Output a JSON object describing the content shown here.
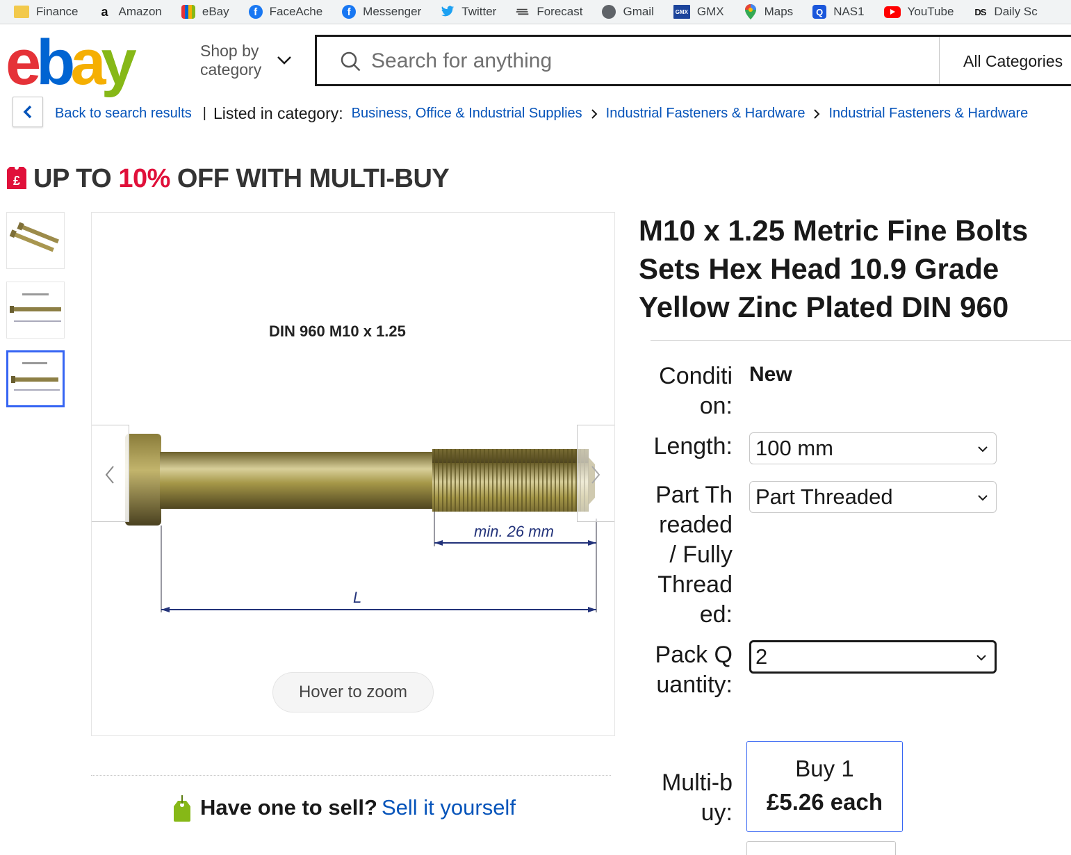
{
  "bookmarks": [
    {
      "label": "Finance",
      "icon": "folder-icon",
      "color": "#f2c94c"
    },
    {
      "label": "Amazon",
      "icon": "amazon-icon",
      "color": "#ffffff"
    },
    {
      "label": "eBay",
      "icon": "ebay-bag-icon",
      "color": "#0064d2"
    },
    {
      "label": "FaceAche",
      "icon": "facebook-icon",
      "color": "#1877f2"
    },
    {
      "label": "Messenger",
      "icon": "facebook-icon",
      "color": "#1877f2"
    },
    {
      "label": "Twitter",
      "icon": "twitter-icon",
      "color": "#1da1f2"
    },
    {
      "label": "Forecast",
      "icon": "forecast-icon",
      "color": "#555555"
    },
    {
      "label": "Gmail",
      "icon": "globe-icon",
      "color": "#5f6368"
    },
    {
      "label": "GMX",
      "icon": "gmx-icon",
      "color": "#1c449b"
    },
    {
      "label": "Maps",
      "icon": "maps-pin-icon",
      "color": "#34a853"
    },
    {
      "label": "NAS1",
      "icon": "nas-icon",
      "color": "#1a56db"
    },
    {
      "label": "YouTube",
      "icon": "youtube-icon",
      "color": "#ff0000"
    },
    {
      "label": "Daily Sc",
      "icon": "ds-icon",
      "color": "#222222"
    }
  ],
  "header": {
    "logo": {
      "e": "e",
      "b": "b",
      "a": "a",
      "y": "y"
    },
    "shop_by_category": "Shop by category",
    "search_placeholder": "Search for anything",
    "category_select": "All Categories"
  },
  "breadcrumb": {
    "back_label": "Back to search results",
    "listed_in": "Listed in category:",
    "items": [
      "Business, Office & Industrial Supplies",
      "Industrial Fasteners & Hardware",
      "Industrial Fasteners & Hardware"
    ]
  },
  "promo": {
    "prefix": "UP TO ",
    "percent": "10%",
    "suffix": " OFF WITH MULTI-BUY"
  },
  "gallery": {
    "image_caption": "DIN 960 M10 x 1.25",
    "dimension_thread": "min. 26 mm",
    "dimension_length": "L",
    "zoom_hint": "Hover to zoom",
    "selected_thumbnail": 3,
    "thumbnail_count": 3
  },
  "sell": {
    "question": "Have one to sell?",
    "link": "Sell it yourself"
  },
  "product": {
    "title": "M10 x 1.25 Metric Fine Bolts Sets Hex Head 10.9 Grade Yellow Zinc Plated DIN 960",
    "condition_label": "Condition:",
    "condition_value": "New",
    "length_label": "Length:",
    "length_value": "100 mm",
    "thread_label": "Part Threaded / Fully Threaded:",
    "thread_value": "Part Threaded",
    "pack_label": "Pack Quantity:",
    "pack_value": "2",
    "multibuy_label": "Multi-buy:",
    "multibuy_qty": "Buy 1",
    "multibuy_price": "£5.26 each"
  },
  "colors": {
    "accent_blue": "#3665f3",
    "link_blue": "#0654ba",
    "promo_red": "#e0103a"
  }
}
